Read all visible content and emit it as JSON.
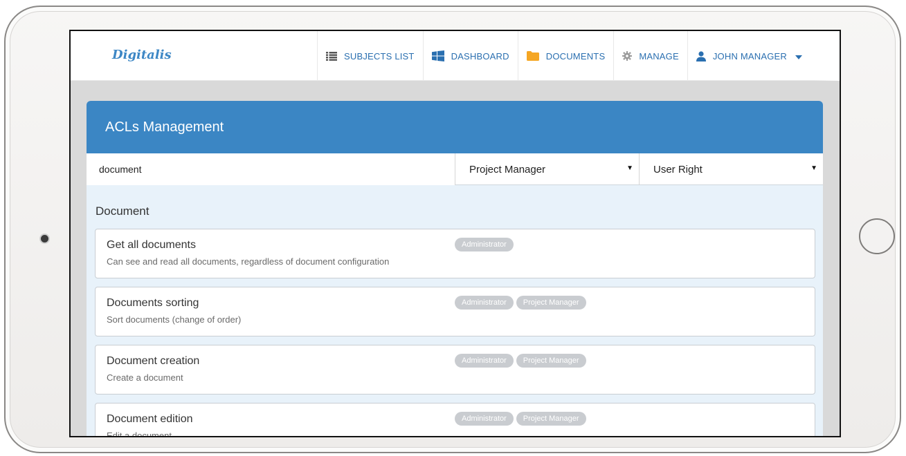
{
  "brand": {
    "logo": "Digitalis",
    "accent": "#3b86c4"
  },
  "nav": {
    "items": [
      {
        "label": "SUBJECTS LIST",
        "icon": "list-icon"
      },
      {
        "label": "DASHBOARD",
        "icon": "windows-icon"
      },
      {
        "label": "DOCUMENTS",
        "icon": "folder-icon"
      },
      {
        "label": "MANAGE",
        "icon": "gear-icon"
      },
      {
        "label": "JOHN MANAGER",
        "icon": "user-icon"
      }
    ]
  },
  "panel": {
    "title": "ACLs Management",
    "filter": {
      "value": "document"
    },
    "role_select": {
      "value": "Project Manager"
    },
    "right_select": {
      "value": "User Right"
    },
    "section": "Document",
    "acls": [
      {
        "name": "Get all documents",
        "description": "Can see and read all documents, regardless of document configuration",
        "roles": [
          "Administrator"
        ]
      },
      {
        "name": "Documents sorting",
        "description": "Sort documents (change of order)",
        "roles": [
          "Administrator",
          "Project Manager"
        ]
      },
      {
        "name": "Document creation",
        "description": "Create a document",
        "roles": [
          "Administrator",
          "Project Manager"
        ]
      },
      {
        "name": "Document edition",
        "description": "Edit a document",
        "roles": [
          "Administrator",
          "Project Manager"
        ]
      }
    ]
  }
}
